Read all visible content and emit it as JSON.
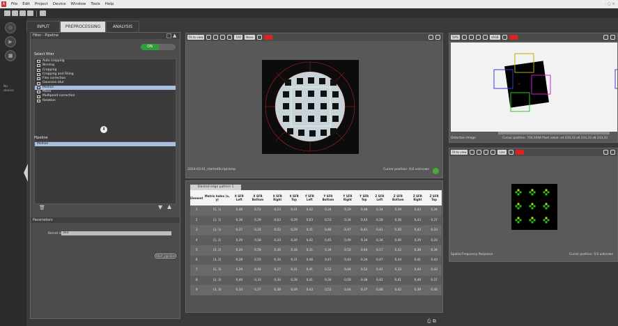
{
  "menu": [
    "File",
    "Edit",
    "Project",
    "Device",
    "Window",
    "Tools",
    "Help"
  ],
  "logo": "A",
  "window_controls": "- ◻ ×",
  "tabs": {
    "input": "INPUT",
    "preprocessing": "PREPROCESSING",
    "analysis": "ANALYSIS"
  },
  "side_text": "No\ndevice",
  "left_panel": {
    "title": "Filter - Pipeline",
    "toggle_on": "ON",
    "select_filter_label": "Select filter",
    "filters": [
      "Auto cropping",
      "Binning",
      "Cropping",
      "Cropping and Filling",
      "Flex correction",
      "Gaussian blur",
      "Median",
      "Moire",
      "Multipoint correction",
      "Rotation"
    ],
    "selected_filter": "Median",
    "pipeline_label": "Pipeline",
    "pipeline_items": [
      "Median"
    ],
    "parameters_label": "Parameters",
    "kernel_label": "Kernel size",
    "kernel_value": "3x3",
    "output_button": "Start pipeline"
  },
  "mid_view": {
    "fit_label": "Fit to view",
    "zoom_label": "100",
    "mode_label": "None",
    "image_name": "2024-03-01_startedScript.bmp",
    "cursor_label": "Cursor position: 0;0   unknown"
  },
  "table": {
    "tab_label": "Slanted edge pattern 1",
    "headers": [
      "Element",
      "Matrix Index (x, y)",
      "X SFR Left",
      "X SFR Bottom",
      "X SFR Right",
      "X SFR Top",
      "Y SFR Left",
      "Y SFR Bottom",
      "Y SFR Right",
      "Y SFR Top",
      "Z SFR Left",
      "Z SFR Bottom",
      "Z SFR Right",
      "Z SFR Top"
    ],
    "rows": [
      [
        "1",
        "(1, 1)",
        "0,48",
        "0,52",
        "0,23",
        "0,31",
        "0,42",
        "0,34",
        "0,19",
        "0,48",
        "0,34",
        "0,39",
        "0,43",
        "0,34"
      ],
      [
        "2",
        "(2, 1)",
        "0,38",
        "0,29",
        "0,63",
        "0,29",
        "0,63",
        "0,53",
        "0,34",
        "0,43",
        "0,18",
        "0,36",
        "0,43",
        "0,37"
      ],
      [
        "3",
        "(3, 1)",
        "0,37",
        "0,24",
        "0,52",
        "0,29",
        "0,31",
        "0,46",
        "0,47",
        "0,41",
        "0,41",
        "0,40",
        "0,42",
        "0,33"
      ],
      [
        "4",
        "(1, 2)",
        "0,39",
        "0,58",
        "0,33",
        "0,34",
        "0,42",
        "0,45",
        "0,49",
        "0,34",
        "0,34",
        "0,40",
        "0,39",
        "0,33"
      ],
      [
        "5",
        "(2, 2)",
        "0,34",
        "0,58",
        "0,36",
        "0,34",
        "0,31",
        "0,34",
        "0,52",
        "0,44",
        "0,17",
        "0,32",
        "0,38",
        "0,34"
      ],
      [
        "6",
        "(3, 2)",
        "0,28",
        "0,55",
        "0,34",
        "0,31",
        "0,46",
        "0,47",
        "0,43",
        "0,34",
        "0,47",
        "0,34",
        "0,41",
        "0,43"
      ],
      [
        "7",
        "(1, 3)",
        "0,29",
        "0,44",
        "0,27",
        "0,31",
        "0,41",
        "0,52",
        "0,44",
        "0,52",
        "0,41",
        "0,33",
        "0,44",
        "0,43"
      ],
      [
        "8",
        "(2, 3)",
        "0,40",
        "0,33",
        "0,34",
        "0,28",
        "0,41",
        "0,34",
        "0,58",
        "0,38",
        "0,42",
        "0,41",
        "0,48",
        "0,37"
      ],
      [
        "9",
        "(3, 3)",
        "0,34",
        "0,37",
        "0,38",
        "0,49",
        "0,43",
        "0,52",
        "0,44",
        "0,37",
        "0,48",
        "0,42",
        "0,39",
        "0,44"
      ]
    ]
  },
  "right_top": {
    "zoom_label": "50%",
    "mode_label": "sRGB",
    "title": "Detection Image",
    "status": "Cursor position: 704;1044  Pixel value: x4 233,33  x6 233,33  x8 233,33"
  },
  "right_bottom": {
    "fit_label": "Fit to view",
    "mode_label": "Line",
    "title": "Spatial Frequency Response",
    "status": "Cursor position: 0;0   unknown"
  },
  "colors": {
    "accent_green": "#2f9e3a",
    "selection": "#a8bfe0",
    "marker_red": "#d22"
  }
}
